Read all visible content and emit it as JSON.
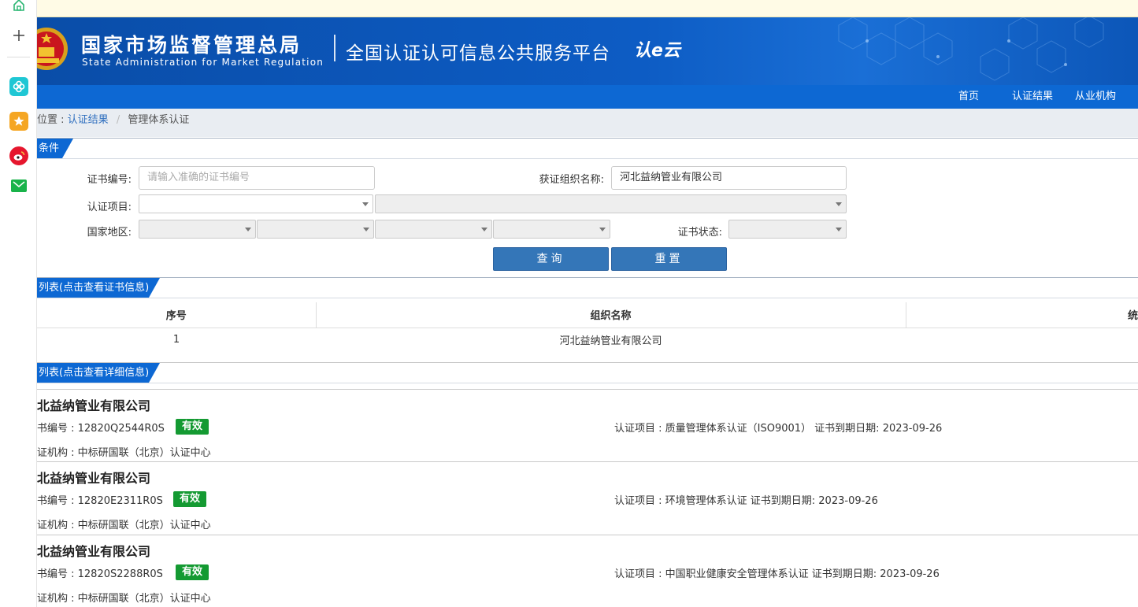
{
  "header": {
    "title_cn": "国家市场监督管理总局",
    "title_en": "State Administration  for  Market Regulation",
    "platform": "全国认证认可信息公共服务平台",
    "logo_text": "认e云"
  },
  "nav": {
    "items": [
      "首页",
      "认证结果",
      "从业机构"
    ]
  },
  "breadcrumb": {
    "prefix": "位置 : ",
    "link": "认证结果",
    "sep": "/",
    "current": "管理体系认证"
  },
  "search": {
    "section_title": "条件",
    "cert_no_label": "证书编号:",
    "cert_no_placeholder": "请输入准确的证书编号",
    "org_label": "获证组织名称:",
    "org_value": "河北益纳管业有限公司",
    "project_label": "认证项目:",
    "region_label": "国家地区:",
    "status_label": "证书状态:",
    "query_button": "查询",
    "reset_button": "重置"
  },
  "org_list": {
    "section_title": "列表(点击查看证书信息)",
    "columns": [
      "序号",
      "组织名称",
      "统"
    ],
    "rows": [
      {
        "index": "1",
        "name": "河北益纳管业有限公司"
      }
    ]
  },
  "cert_list": {
    "section_title": "列表(点击查看详细信息)",
    "items": [
      {
        "name": "北益纳管业有限公司",
        "cert_no": "书编号 : 12820Q2544R0S",
        "status": "有效",
        "project": "认证项目 : 质量管理体系认证（ISO9001）   证书到期日期: 2023-09-26",
        "org": "证机构 : 中标研国联（北京）认证中心"
      },
      {
        "name": "北益纳管业有限公司",
        "cert_no": "书编号 : 12820E2311R0S",
        "status": "有效",
        "project": "认证项目 : 环境管理体系认证   证书到期日期: 2023-09-26",
        "org": "证机构 : 中标研国联（北京）认证中心"
      },
      {
        "name": "北益纳管业有限公司",
        "cert_no": "书编号 : 12820S2288R0S",
        "status": "有效",
        "project": "认证项目 : 中国职业健康安全管理体系认证   证书到期日期: 2023-09-26",
        "org": "证机构 : 中标研国联（北京）认证中心"
      }
    ]
  },
  "colors": {
    "brand_blue": "#0d68d3",
    "valid_green": "#149a32",
    "button_blue": "#3476b8"
  },
  "sidebar_icons": [
    "home-icon",
    "plus-icon",
    "clover-app-icon",
    "star-favorites-icon",
    "weibo-icon",
    "mail-icon"
  ]
}
